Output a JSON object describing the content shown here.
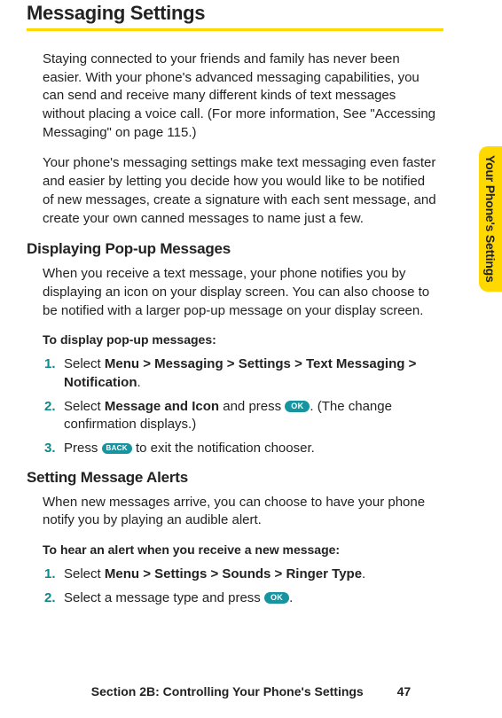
{
  "title": "Messaging Settings",
  "intro1": "Staying connected to your friends and family has never been easier. With your phone's advanced messaging capabilities, you can send and receive many different kinds of text messages without placing a voice call. (For more information, See \"Accessing Messaging\" on page 115.)",
  "intro2": "Your phone's messaging settings make text messaging even faster and easier by letting you decide how you would like to be notified of new messages, create a signature with each sent message, and create your own canned messages to name just a few.",
  "sideTab": "Your Phone's Settings",
  "sections": {
    "popups": {
      "heading": "Displaying Pop-up Messages",
      "intro": "When you receive a text message, your phone notifies you by displaying an icon on your display screen. You can also choose to be notified with a larger pop-up message on your display screen.",
      "howto": "To display pop-up messages:",
      "steps": [
        {
          "num": "1.",
          "pre": "Select ",
          "bold": "Menu > Messaging > Settings > Text Messaging > Notification",
          "post": "."
        },
        {
          "num": "2.",
          "pre": "Select ",
          "bold": "Message and Icon",
          "mid": " and press ",
          "pill": "OK",
          "post": ". (The change confirmation displays.)"
        },
        {
          "num": "3.",
          "pre": "Press ",
          "pill": "BACK",
          "post": " to exit the notification chooser."
        }
      ]
    },
    "alerts": {
      "heading": "Setting Message Alerts",
      "intro": "When new messages arrive, you can choose to have your phone notify you by playing an audible alert.",
      "howto": "To hear an alert when you receive a new message:",
      "steps": [
        {
          "num": "1.",
          "pre": "Select ",
          "bold": "Menu > Settings > Sounds > Ringer Type",
          "post": "."
        },
        {
          "num": "2.",
          "pre": "Select a message type and press ",
          "pill": "OK",
          "post": "."
        }
      ]
    }
  },
  "footer": {
    "text": "Section 2B: Controlling Your Phone's Settings",
    "page": "47"
  }
}
